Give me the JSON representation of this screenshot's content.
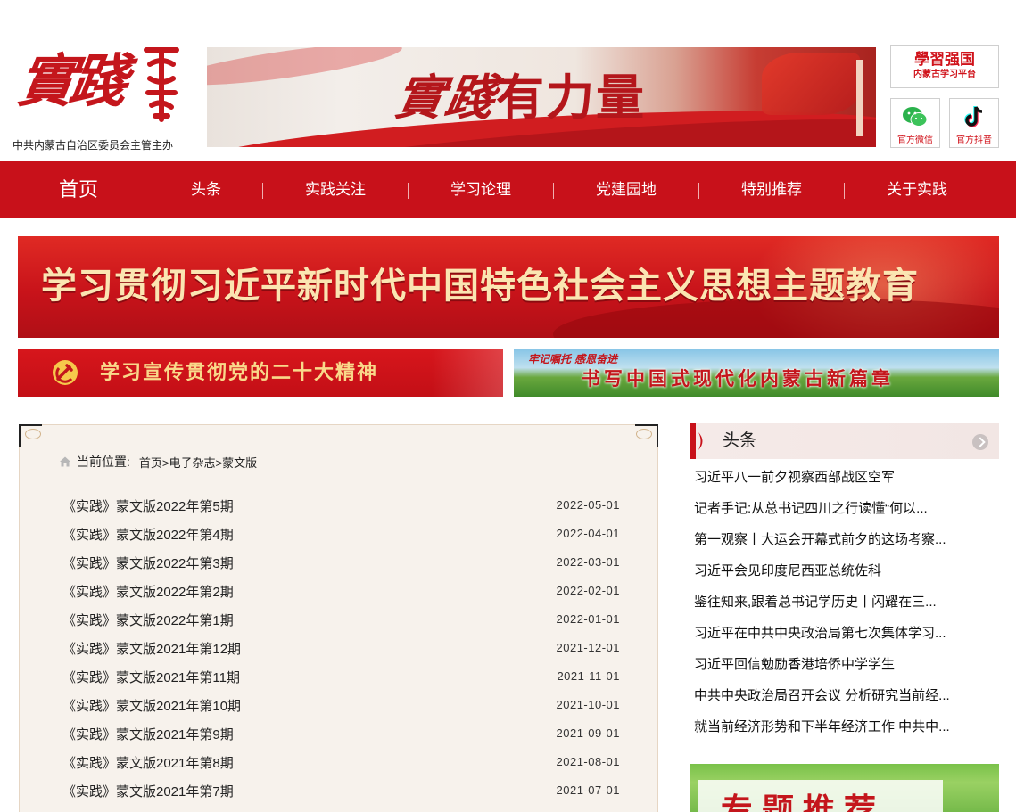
{
  "header": {
    "logo_mark": "實踐",
    "logo_subtitle": "中共内蒙古自治区委员会主管主办",
    "banner_title_cursive": "實踐",
    "banner_title_rest": "有力量",
    "qiangguo": {
      "main": "學習强国",
      "sub": "内蒙古学习平台"
    },
    "social": [
      {
        "icon": "wechat-icon",
        "label": "官方微信"
      },
      {
        "icon": "douyin-icon",
        "label": "官方抖音"
      }
    ]
  },
  "nav": {
    "home": "首页",
    "items": [
      "头条",
      "实践关注",
      "学习论理",
      "党建园地",
      "特别推荐",
      "关于实践"
    ]
  },
  "banners": {
    "main": "学习贯彻习近平新时代中国特色社会主义思想主题教育",
    "left": "学习宣传贯彻党的二十大精神",
    "right_kicker": "牢记嘱托 感恩奋进",
    "right": "书写中国式现代化内蒙古新篇章"
  },
  "breadcrumb": {
    "label": "当前位置:",
    "path": "首页>电子杂志>蒙文版"
  },
  "issues": [
    {
      "title": "《实践》蒙文版2022年第5期",
      "date": "2022-05-01"
    },
    {
      "title": "《实践》蒙文版2022年第4期",
      "date": "2022-04-01"
    },
    {
      "title": "《实践》蒙文版2022年第3期",
      "date": "2022-03-01"
    },
    {
      "title": "《实践》蒙文版2022年第2期",
      "date": "2022-02-01"
    },
    {
      "title": "《实践》蒙文版2022年第1期",
      "date": "2022-01-01"
    },
    {
      "title": "《实践》蒙文版2021年第12期",
      "date": "2021-12-01"
    },
    {
      "title": "《实践》蒙文版2021年第11期",
      "date": "2021-11-01"
    },
    {
      "title": "《实践》蒙文版2021年第10期",
      "date": "2021-10-01"
    },
    {
      "title": "《实践》蒙文版2021年第9期",
      "date": "2021-09-01"
    },
    {
      "title": "《实践》蒙文版2021年第8期",
      "date": "2021-08-01"
    },
    {
      "title": "《实践》蒙文版2021年第7期",
      "date": "2021-07-01"
    }
  ],
  "sidebar": {
    "title": "头条",
    "news": [
      "习近平八一前夕视察西部战区空军",
      "记者手记:从总书记四川之行读懂“何以...",
      "第一观察丨大运会开幕式前夕的这场考察...",
      "习近平会见印度尼西亚总统佐科",
      "鉴往知来,跟着总书记学历史丨闪耀在三...",
      "习近平在中共中央政治局第七次集体学习...",
      "习近平回信勉励香港培侨中学学生",
      "中共中央政治局召开会议 分析研究当前经...",
      "就当前经济形势和下半年经济工作 中共中..."
    ],
    "promo_text": "专题推荐"
  },
  "colors": {
    "brand_red": "#c8111a",
    "gold_text": "#fbe5b2",
    "panel_bg": "#f7f2ec"
  }
}
